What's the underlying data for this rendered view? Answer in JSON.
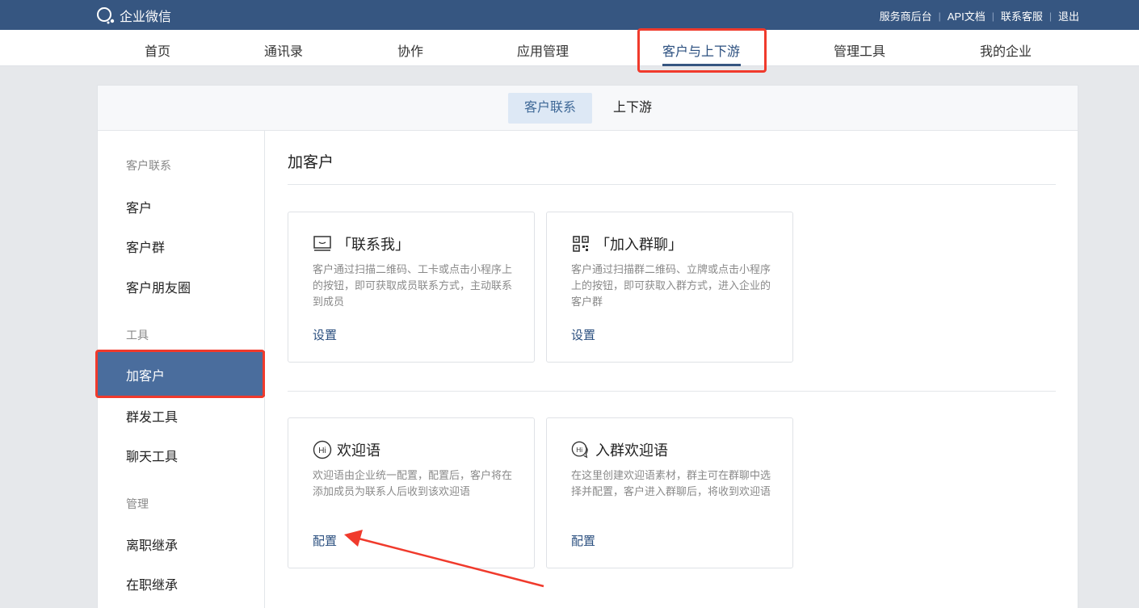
{
  "app": {
    "title": "企业微信"
  },
  "toplinks": [
    "服务商后台",
    "API文档",
    "联系客服",
    "退出"
  ],
  "nav": [
    "首页",
    "通讯录",
    "协作",
    "应用管理",
    "客户与上下游",
    "管理工具",
    "我的企业"
  ],
  "subtabs": [
    "客户联系",
    "上下游"
  ],
  "sidebar": {
    "sections": [
      "客户联系",
      "工具",
      "管理"
    ],
    "items": [
      "客户",
      "客户群",
      "客户朋友圈",
      "加客户",
      "群发工具",
      "聊天工具",
      "离职继承",
      "在职继承"
    ]
  },
  "content": {
    "title": "加客户",
    "cards": [
      {
        "title": "「联系我」",
        "icon": "contact-me-icon",
        "desc": "客户通过扫描二维码、工卡或点击小程序上的按钮，即可获取成员联系方式，主动联系到成员",
        "action": "设置"
      },
      {
        "title": "「加入群聊」",
        "icon": "qrcode-icon",
        "desc": "客户通过扫描群二维码、立牌或点击小程序上的按钮，即可获取入群方式，进入企业的客户群",
        "action": "设置"
      },
      {
        "title": "欢迎语",
        "icon": "hi-icon",
        "desc": "欢迎语由企业统一配置，配置后，客户将在添加成员为联系人后收到该欢迎语",
        "action": "配置"
      },
      {
        "title": "入群欢迎语",
        "icon": "hi-chat-icon",
        "desc": "在这里创建欢迎语素材，群主可在群聊中选择并配置，客户进入群聊后，将收到欢迎语",
        "action": "配置"
      }
    ]
  },
  "colors": {
    "topbar": "#365681",
    "accent": "#4a6d9d",
    "annotation": "#f03a2c"
  }
}
